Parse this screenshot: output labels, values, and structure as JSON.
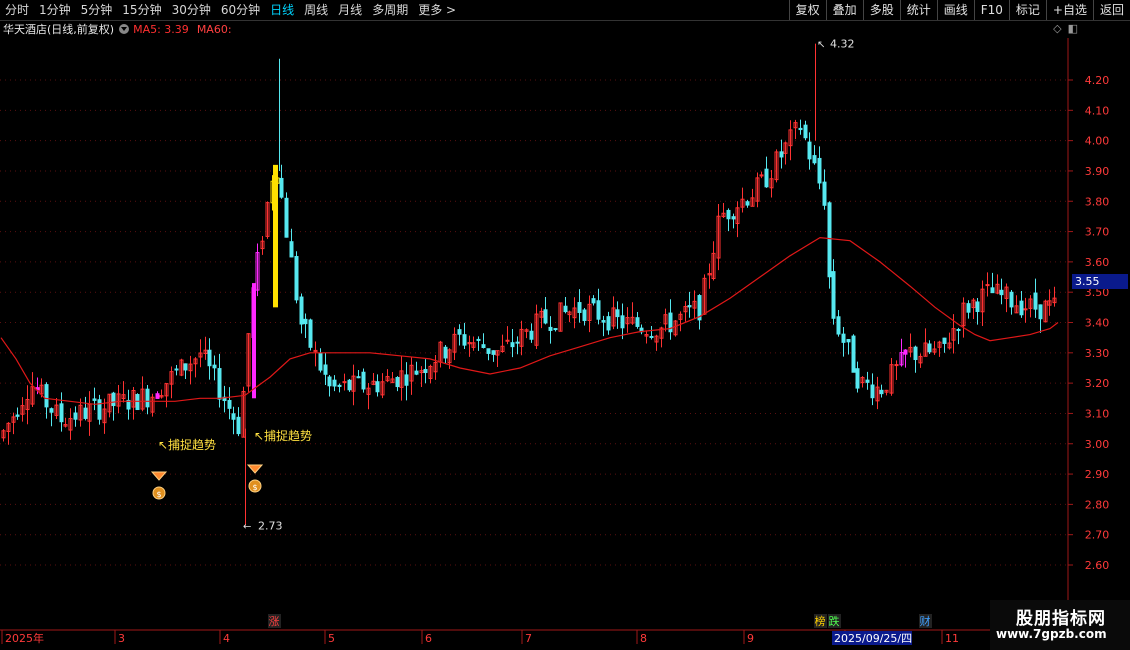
{
  "toolbar": {
    "periods": [
      "分时",
      "1分钟",
      "5分钟",
      "15分钟",
      "30分钟",
      "60分钟",
      "日线",
      "周线",
      "月线",
      "多周期",
      "更多 >"
    ],
    "active_index": 6,
    "buttons": [
      "复权",
      "叠加",
      "多股",
      "统计",
      "画线",
      "F10",
      "标记",
      "+自选",
      "返回"
    ]
  },
  "info": {
    "stock": "华天酒店(日线,前复权)",
    "ma5": "MA5: 3.39",
    "ma60": "MA60:"
  },
  "corner_icons": [
    "diamond-outline-icon",
    "panel-toggle-icon"
  ],
  "price_badge": "3.55",
  "chart_data": {
    "type": "candlestick",
    "ylim": [
      2.6,
      4.32
    ],
    "y_ticks": [
      "4.20",
      "4.10",
      "4.00",
      "3.90",
      "3.80",
      "3.70",
      "3.60",
      "3.50",
      "3.40",
      "3.30",
      "3.20",
      "3.10",
      "3.00",
      "2.90",
      "2.80",
      "2.70",
      "2.60"
    ],
    "x_labels": [
      "2025年",
      "3",
      "4",
      "5",
      "6",
      "7",
      "8",
      "9",
      "10",
      "11"
    ],
    "high_label": "4.32",
    "low_label": "2.73",
    "signal_text": "捕捉趋势",
    "markers": [
      "涨",
      "榜",
      "跌",
      "财"
    ],
    "date_label": "2025/09/25/四",
    "ma60_line": [
      [
        1,
        3.35
      ],
      [
        16,
        3.28
      ],
      [
        30,
        3.2
      ],
      [
        45,
        3.15
      ],
      [
        70,
        3.14
      ],
      [
        95,
        3.13
      ],
      [
        120,
        3.14
      ],
      [
        150,
        3.14
      ],
      [
        175,
        3.14
      ],
      [
        200,
        3.15
      ],
      [
        220,
        3.15
      ],
      [
        245,
        3.16
      ],
      [
        270,
        3.22
      ],
      [
        290,
        3.28
      ],
      [
        310,
        3.3
      ],
      [
        340,
        3.3
      ],
      [
        370,
        3.3
      ],
      [
        400,
        3.29
      ],
      [
        430,
        3.28
      ],
      [
        460,
        3.25
      ],
      [
        490,
        3.23
      ],
      [
        520,
        3.25
      ],
      [
        550,
        3.29
      ],
      [
        580,
        3.32
      ],
      [
        610,
        3.35
      ],
      [
        640,
        3.37
      ],
      [
        670,
        3.38
      ],
      [
        700,
        3.42
      ],
      [
        730,
        3.48
      ],
      [
        760,
        3.55
      ],
      [
        790,
        3.62
      ],
      [
        820,
        3.68
      ],
      [
        850,
        3.67
      ],
      [
        880,
        3.6
      ],
      [
        910,
        3.52
      ],
      [
        935,
        3.45
      ],
      [
        960,
        3.39
      ],
      [
        975,
        3.36
      ],
      [
        990,
        3.34
      ],
      [
        1010,
        3.35
      ],
      [
        1030,
        3.36
      ],
      [
        1050,
        3.38
      ],
      [
        1058,
        3.4
      ]
    ]
  },
  "watermark": {
    "line1": "股朋指标网",
    "line2": "www.7gpzb.com"
  }
}
